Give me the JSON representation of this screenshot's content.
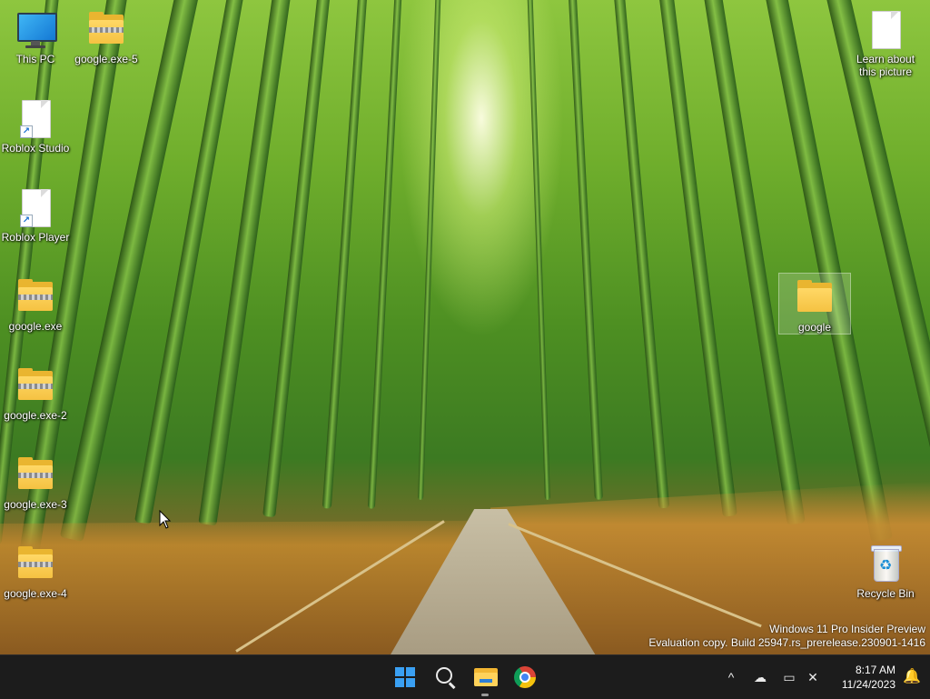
{
  "desktop": {
    "icons": [
      {
        "label": "This PC",
        "icon": "computer-icon"
      },
      {
        "label": "google.exe-5",
        "icon": "zip-folder-icon"
      },
      {
        "label": "Roblox Studio",
        "icon": "shortcut-file-icon"
      },
      {
        "label": "Roblox Player",
        "icon": "shortcut-file-icon"
      },
      {
        "label": "google.exe",
        "icon": "zip-folder-icon"
      },
      {
        "label": "google.exe-2",
        "icon": "zip-folder-icon"
      },
      {
        "label": "google.exe-3",
        "icon": "zip-folder-icon"
      },
      {
        "label": "google.exe-4",
        "icon": "zip-folder-icon"
      },
      {
        "label": "Learn about this picture",
        "icon": "file-icon"
      },
      {
        "label": "google",
        "icon": "folder-icon"
      },
      {
        "label": "Recycle Bin",
        "icon": "recycle-bin-icon"
      }
    ],
    "watermark": {
      "line1": "Windows 11 Pro Insider Preview",
      "line2": "Evaluation copy. Build 25947.rs_prerelease.230901-1416"
    }
  },
  "taskbar": {
    "apps": [
      {
        "name": "Start",
        "icon": "windows-start-icon"
      },
      {
        "name": "Search",
        "icon": "search-icon"
      },
      {
        "name": "File Explorer",
        "icon": "file-explorer-icon"
      },
      {
        "name": "Google Chrome",
        "icon": "chrome-icon"
      }
    ],
    "tray": {
      "chevron": "^",
      "onedrive": "☁",
      "network": "▭",
      "volume": "✕"
    },
    "clock": {
      "time": "8:17 AM",
      "date": "11/24/2023"
    },
    "notification": "🔔"
  }
}
